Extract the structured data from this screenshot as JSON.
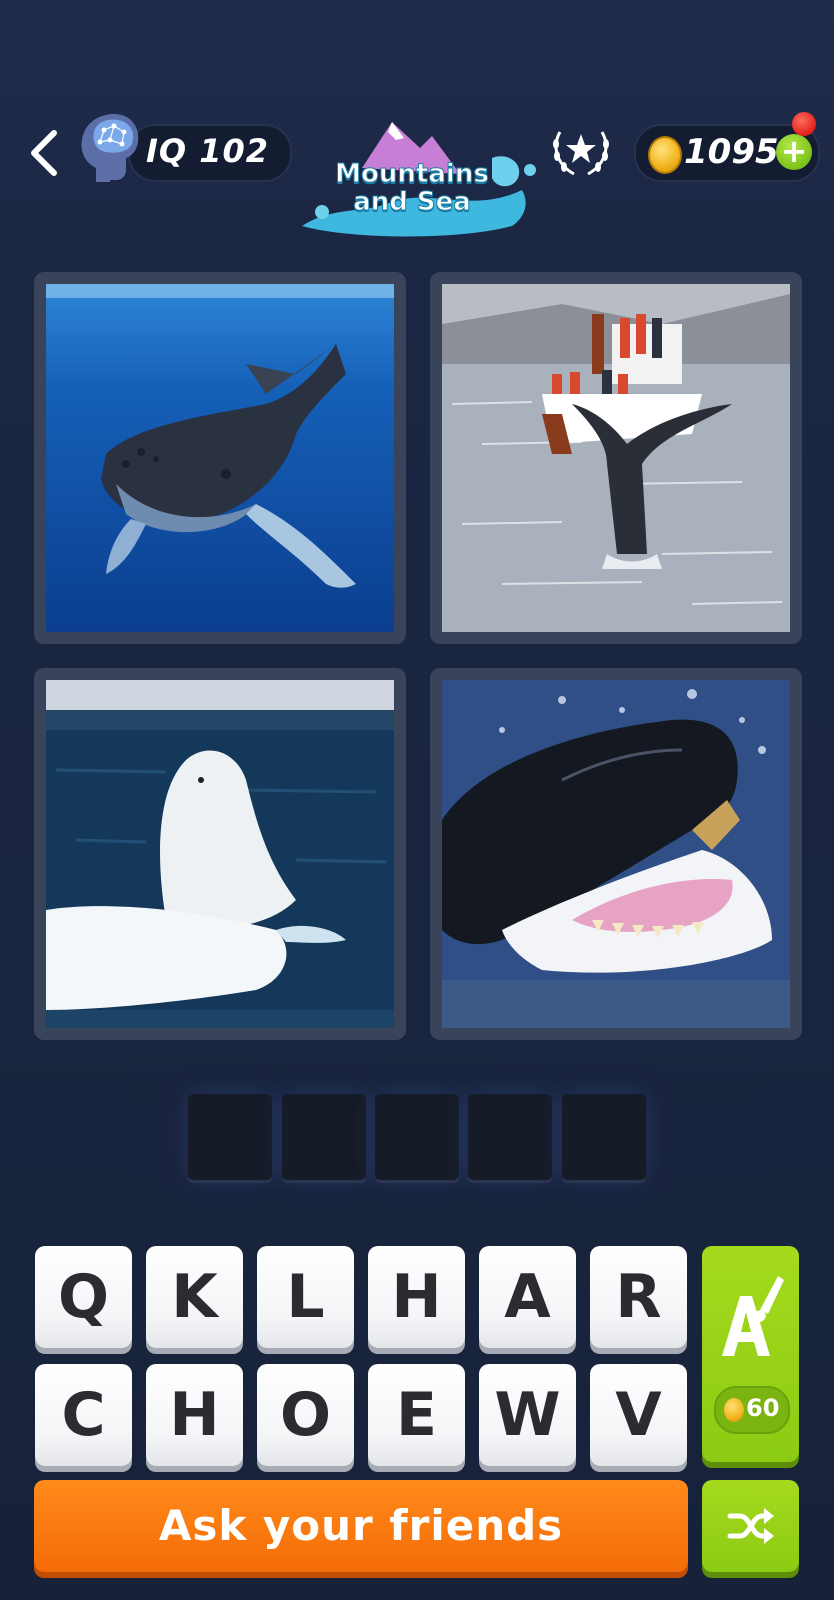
{
  "header": {
    "iq_label": "IQ 102",
    "level_name": "Mountains and Sea",
    "coins": "1095",
    "plus_label": "+",
    "icons": {
      "back": "chevron-left-icon",
      "brain": "brain-head-icon",
      "achievements": "laurel-star-icon",
      "coin": "coin-icon",
      "notification": "notification-dot-icon"
    }
  },
  "puzzle": {
    "images": [
      {
        "subject": "humpback whale underwater"
      },
      {
        "subject": "whale tail near boat"
      },
      {
        "subject": "beluga whale"
      },
      {
        "subject": "orca with open mouth"
      }
    ],
    "answer_slots": [
      "",
      "",
      "",
      "",
      ""
    ]
  },
  "keyboard": {
    "row1": [
      "Q",
      "K",
      "L",
      "H",
      "A",
      "R"
    ],
    "row2": [
      "C",
      "H",
      "O",
      "E",
      "W",
      "V"
    ]
  },
  "hint": {
    "price": "60",
    "icon": "letter-brush-icon"
  },
  "actions": {
    "ask_label": "Ask your friends",
    "shuffle_icon": "shuffle-icon"
  },
  "colors": {
    "background": "#1a2540",
    "orange_button": "#f46c07",
    "green_button": "#8ccb14",
    "key_face": "#f4f5f7"
  }
}
